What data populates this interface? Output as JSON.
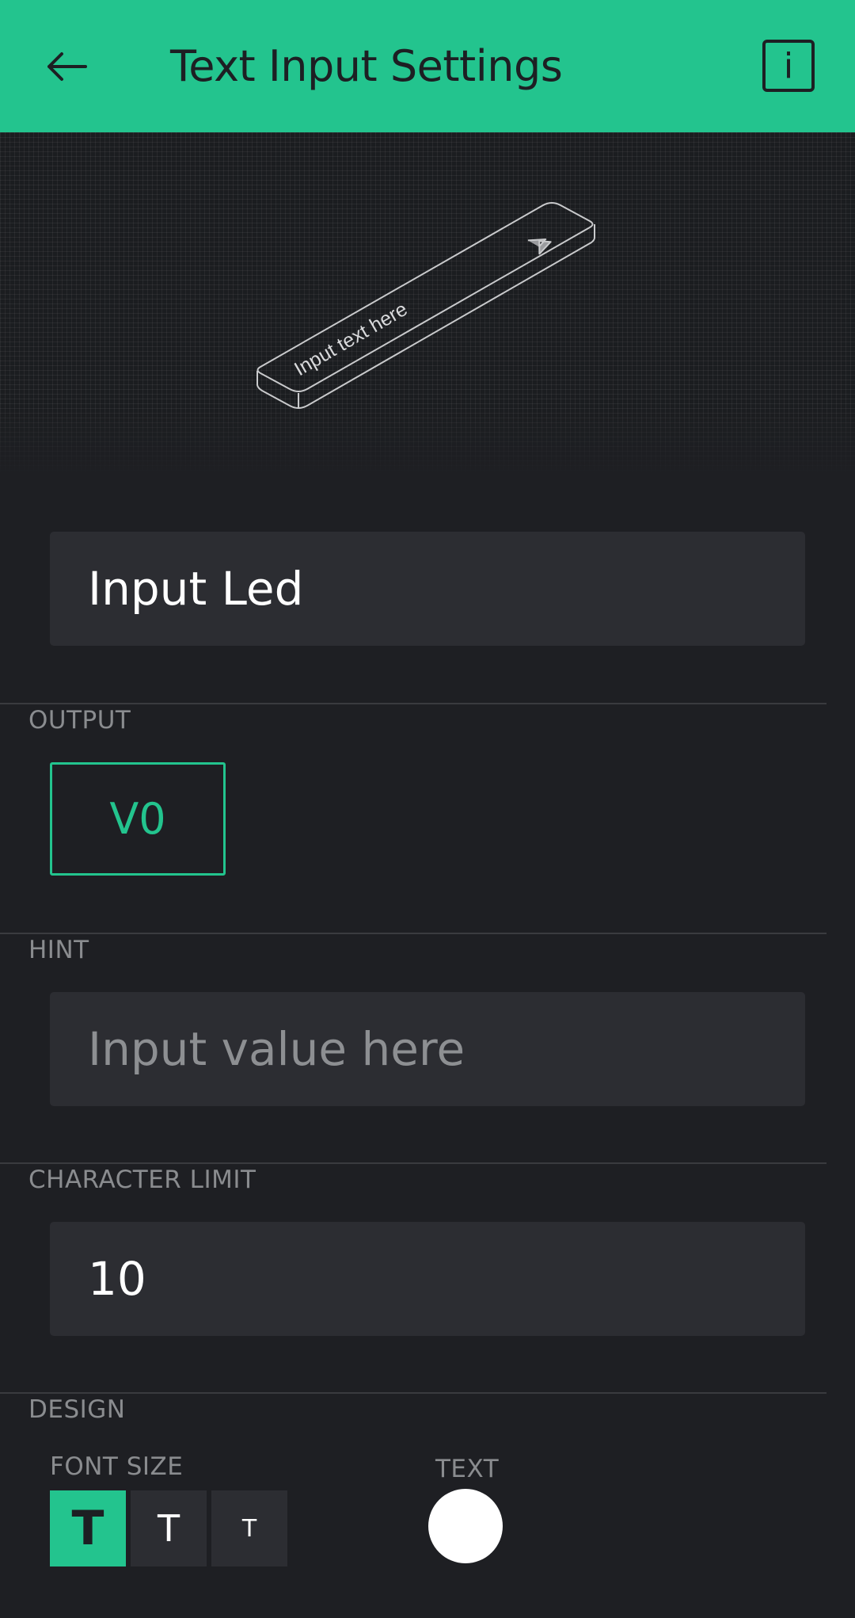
{
  "header": {
    "title": "Text Input Settings",
    "back_icon": "arrow-left-icon",
    "info_icon_label": "i",
    "background": "#23c48e"
  },
  "preview": {
    "widget_placeholder": "Input text here",
    "send_icon": "send-arrow-icon"
  },
  "name_field": {
    "value": "Input Led"
  },
  "output": {
    "label": "OUTPUT",
    "pin": "V0"
  },
  "hint": {
    "label": "HINT",
    "placeholder": "Input value here"
  },
  "character_limit": {
    "label": "CHARACTER LIMIT",
    "value": "10"
  },
  "design": {
    "label": "DESIGN",
    "font_size": {
      "label": "FONT SIZE",
      "options": [
        {
          "glyph": "T",
          "size": "large",
          "selected": true
        },
        {
          "glyph": "T",
          "size": "medium",
          "selected": false
        },
        {
          "glyph": "T",
          "size": "small",
          "selected": false
        }
      ]
    },
    "text_color": {
      "label": "TEXT",
      "color": "#ffffff"
    }
  },
  "colors": {
    "accent": "#23c48e",
    "background": "#1e1f23",
    "field": "#2c2d32",
    "muted_text": "#8a8c8f"
  }
}
